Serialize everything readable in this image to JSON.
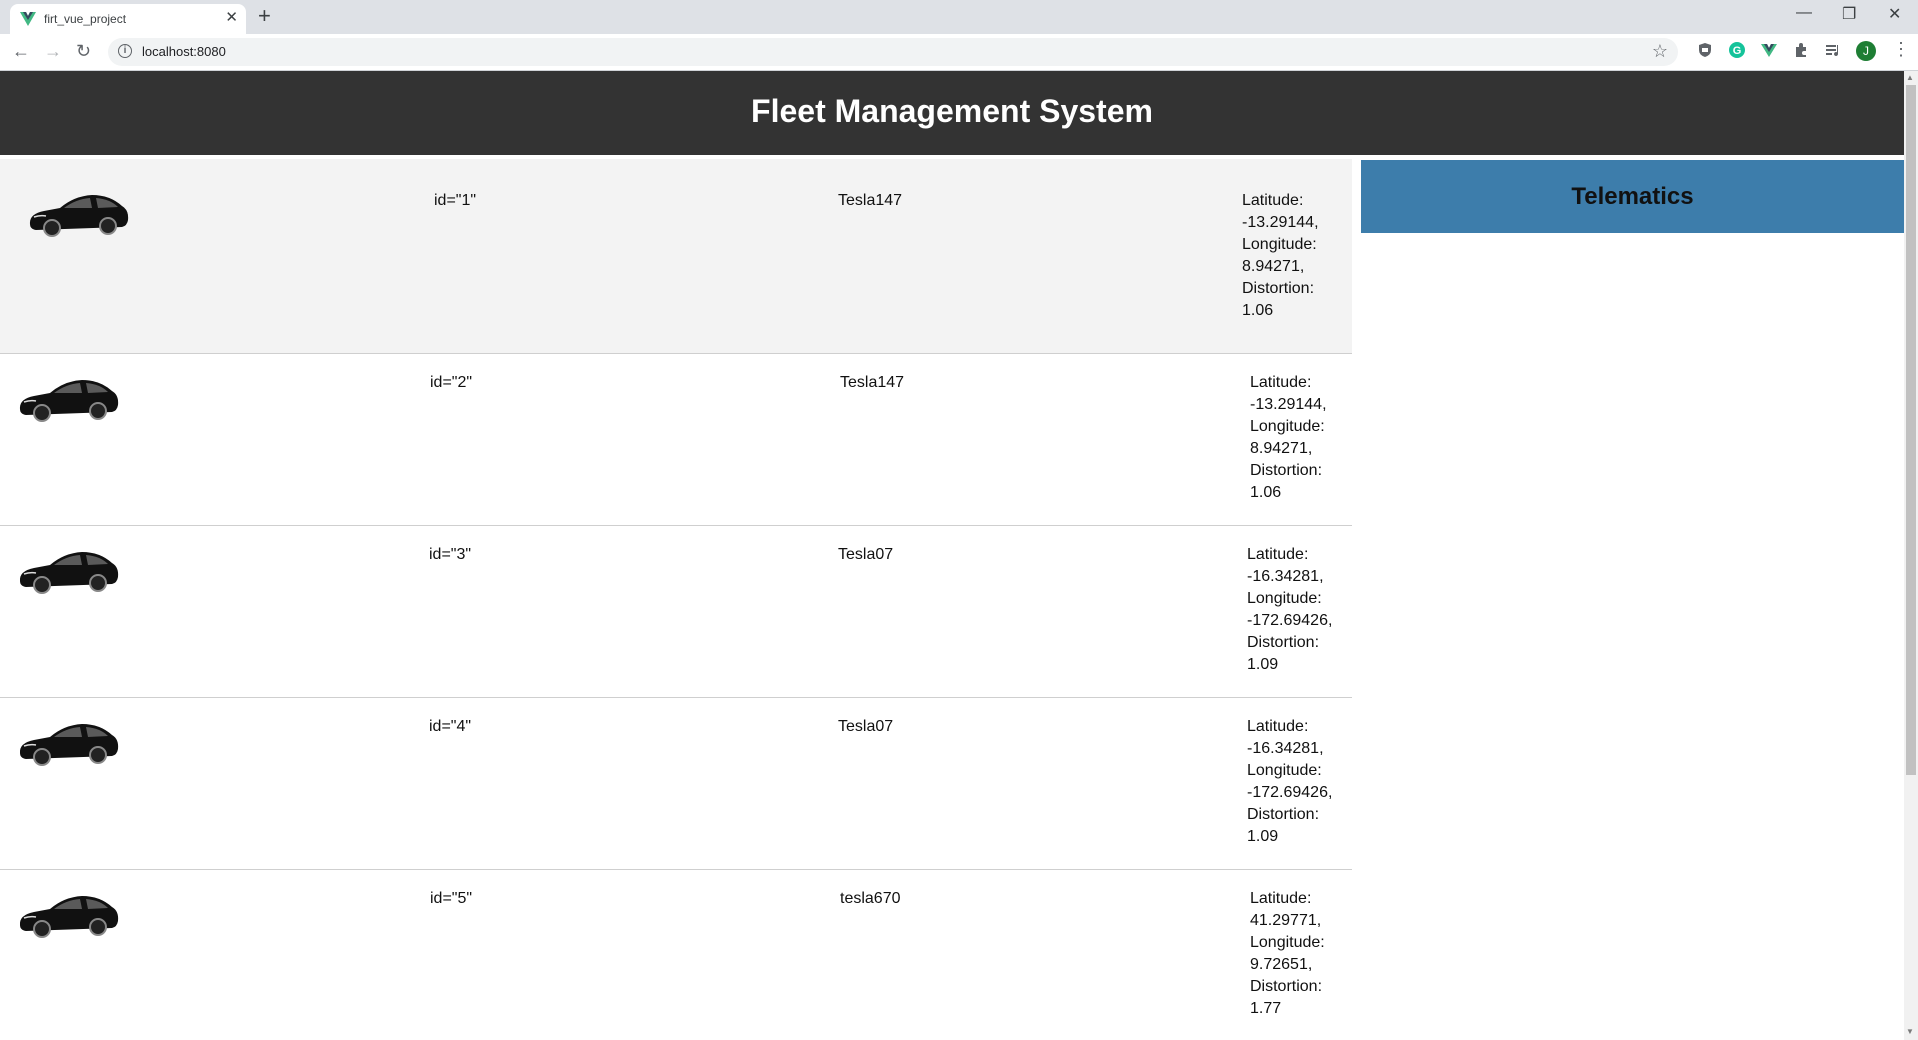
{
  "browser": {
    "tab_title": "firt_vue_project",
    "url": "localhost:8080",
    "avatar_initial": "J"
  },
  "app": {
    "title": "Fleet Management System"
  },
  "telematics": {
    "title": "Telematics"
  },
  "vehicles": [
    {
      "id_text": "id=\"1\"",
      "name": "Tesla147",
      "lat_label": "Latitude:",
      "lat": "-13.29144,",
      "lon_label": "Longitude:",
      "lon": "8.94271,",
      "dist_label": "Distortion:",
      "dist": "1.06"
    },
    {
      "id_text": "id=\"2\"",
      "name": "Tesla147",
      "lat_label": "Latitude:",
      "lat": "-13.29144,",
      "lon_label": "Longitude:",
      "lon": "8.94271,",
      "dist_label": "Distortion:",
      "dist": "1.06"
    },
    {
      "id_text": "id=\"3\"",
      "name": "Tesla07",
      "lat_label": "Latitude:",
      "lat": "-16.34281,",
      "lon_label": "Longitude:",
      "lon": "-172.69426,",
      "dist_label": "Distortion:",
      "dist": "1.09"
    },
    {
      "id_text": "id=\"4\"",
      "name": "Tesla07",
      "lat_label": "Latitude:",
      "lat": "-16.34281,",
      "lon_label": "Longitude:",
      "lon": "-172.69426,",
      "dist_label": "Distortion:",
      "dist": "1.09"
    },
    {
      "id_text": "id=\"5\"",
      "name": "tesla670",
      "lat_label": "Latitude:",
      "lat": "41.29771,",
      "lon_label": "Longitude:",
      "lon": "9.72651,",
      "dist_label": "Distortion:",
      "dist": "1.77"
    }
  ],
  "colors": {
    "header_bg": "#333333",
    "telematics_bg": "#3d7dab",
    "selected_row_bg": "#f3f3f3"
  }
}
